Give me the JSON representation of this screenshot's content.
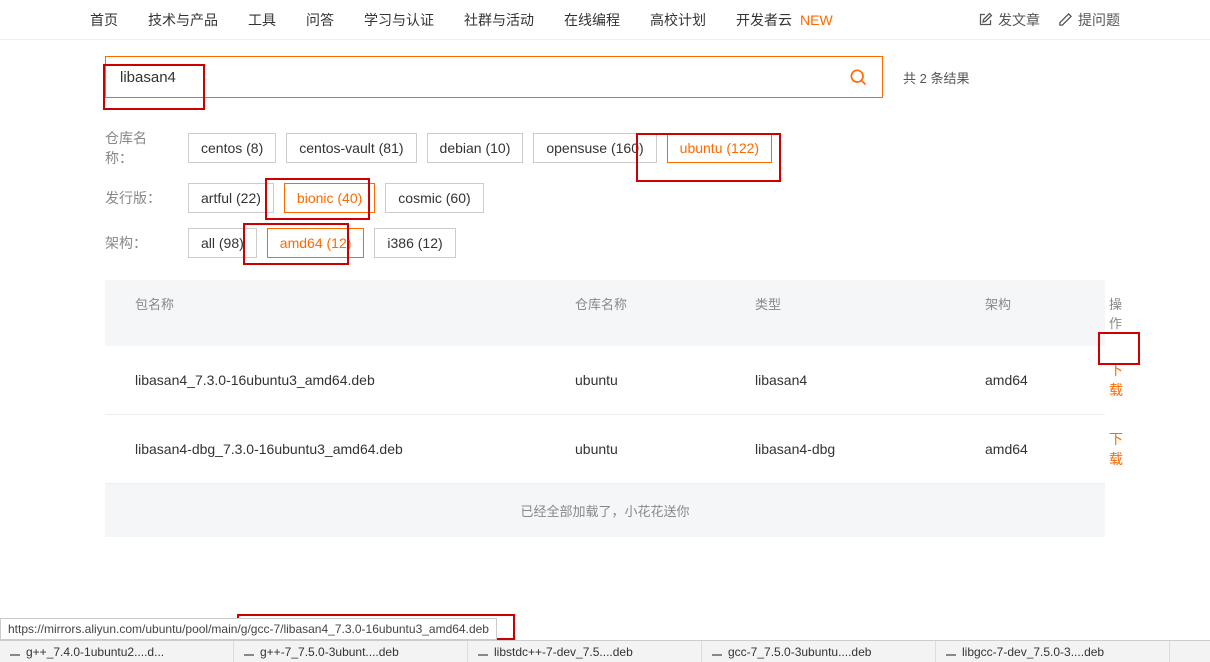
{
  "nav": {
    "items": [
      "首页",
      "技术与产品",
      "工具",
      "问答",
      "学习与认证",
      "社群与活动",
      "在线编程",
      "高校计划",
      "开发者云"
    ],
    "new_label": "NEW",
    "write_article": "发文章",
    "ask_question": "提问题"
  },
  "search": {
    "value": "libasan4",
    "result_count": "共 2 条结果"
  },
  "filters": {
    "repo_label": "仓库名称：",
    "repo_tags": [
      {
        "label": "centos (8)",
        "active": false
      },
      {
        "label": "centos-vault (81)",
        "active": false
      },
      {
        "label": "debian (10)",
        "active": false
      },
      {
        "label": "opensuse (160)",
        "active": false
      },
      {
        "label": "ubuntu (122)",
        "active": true
      }
    ],
    "dist_label": "发行版：",
    "dist_tags": [
      {
        "label": "artful (22)",
        "active": false
      },
      {
        "label": "bionic (40)",
        "active": true
      },
      {
        "label": "cosmic (60)",
        "active": false
      }
    ],
    "arch_label": "架构：",
    "arch_tags": [
      {
        "label": "all (98)",
        "active": false
      },
      {
        "label": "amd64 (12)",
        "active": true
      },
      {
        "label": "i386 (12)",
        "active": false
      }
    ]
  },
  "table": {
    "headers": {
      "name": "包名称",
      "repo": "仓库名称",
      "type": "类型",
      "arch": "架构",
      "op": "操作"
    },
    "rows": [
      {
        "name": "libasan4_7.3.0-16ubuntu3_amd64.deb",
        "repo": "ubuntu",
        "type": "libasan4",
        "arch": "amd64",
        "op": "下载"
      },
      {
        "name": "libasan4-dbg_7.3.0-16ubuntu3_amd64.deb",
        "repo": "ubuntu",
        "type": "libasan4-dbg",
        "arch": "amd64",
        "op": "下载"
      }
    ],
    "loaded_msg": "已经全部加载了，小花花送你"
  },
  "status_url": "https://mirrors.aliyun.com/ubuntu/pool/main/g/gcc-7/libasan4_7.3.0-16ubuntu3_amd64.deb",
  "browser_tabs": [
    "g++_7.4.0-1ubuntu2....d...",
    "g++-7_7.5.0-3ubunt....deb",
    "libstdc++-7-dev_7.5....deb",
    "gcc-7_7.5.0-3ubuntu....deb",
    "libgcc-7-dev_7.5.0-3....deb"
  ]
}
